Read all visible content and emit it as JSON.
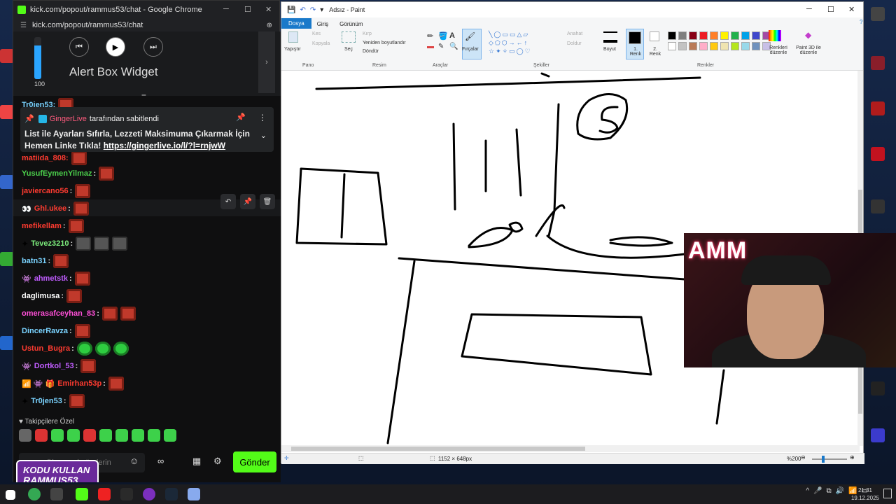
{
  "chrome": {
    "title": "kick.com/popout/rammus53/chat - Google Chrome",
    "url": "kick.com/popout/rammus53/chat"
  },
  "widget": {
    "title": "Alert Box Widget",
    "volume": "100",
    "volume_fraction": 0.8
  },
  "pinned": {
    "user": "GingerLive",
    "action": "tarafından sabitlendi",
    "text": "List ile Ayarları Sıfırla, Lezzeti Maksimuma Çıkarmak İçin Hemen Linke Tıkla!",
    "link": "https://gingerlive.io/l/?l=rnjwW"
  },
  "chat": {
    "partial_top": "Tr0jen53:",
    "partial_top2": "matiida_808:",
    "messages": [
      {
        "user": "YusufEymenYilmaz",
        "color": "#4bcf4b",
        "emotes": [
          "r"
        ]
      },
      {
        "user": "javiercano56",
        "color": "#ff3b30",
        "emotes": [
          "r"
        ]
      },
      {
        "user": "Ghl.ukee",
        "color": "#ff3b30",
        "emotes": [
          "r"
        ],
        "badge": "👀"
      },
      {
        "user": "mefikellam",
        "color": "#ff3b30",
        "emotes": [
          "r"
        ]
      },
      {
        "user": "Tevez3210",
        "color": "#7ef07e",
        "emotes": [
          "p",
          "p",
          "p"
        ],
        "badge": "✦"
      },
      {
        "user": "batn31",
        "color": "#7ad3ff",
        "emotes": [
          "r"
        ]
      },
      {
        "user": "ahmetstk",
        "color": "#c05cff",
        "emotes": [
          "r"
        ],
        "badge": "👾"
      },
      {
        "user": "daglimusa",
        "color": "#ffffff",
        "emotes": [
          "r"
        ]
      },
      {
        "user": "omerasafceyhan_83",
        "color": "#ff4fd8",
        "emotes": [
          "r",
          "r"
        ]
      },
      {
        "user": "DincerRavza",
        "color": "#7ad3ff",
        "emotes": [
          "r"
        ]
      },
      {
        "user": "Ustun_Bugra",
        "color": "#ff3b30",
        "emotes": [
          "g",
          "g",
          "g"
        ]
      },
      {
        "user": "Dortkol_53",
        "color": "#c05cff",
        "emotes": [
          "r"
        ],
        "badge": "👾"
      },
      {
        "user": "Emirhan53p",
        "color": "#ff3b30",
        "emotes": [
          "r"
        ],
        "badge": "📶 👾 🎁"
      },
      {
        "user": "Tr0jen53",
        "color": "#7ad3ff",
        "emotes": [
          "r"
        ],
        "badge": "✦"
      }
    ],
    "followers_label": "Takipçilere Özel",
    "composer_placeholder": "Bir mesaj gönderin",
    "send_label": "Gönder",
    "promo_line1": "KODU KULLAN",
    "promo_line2": "RAMMUS53"
  },
  "paint": {
    "title": "Adsız - Paint",
    "tabs": [
      "Dosya",
      "Giriş",
      "Görünüm"
    ],
    "groups": {
      "pano": "Pano",
      "resim": "Resim",
      "araclar": "Araçlar",
      "sekiller": "Şekiller",
      "renkler": "Renkler"
    },
    "items": {
      "yapistir": "Yapıştır",
      "kes": "Kes",
      "kopyala": "Kopyala",
      "sec": "Seç",
      "kirp": "Kırp",
      "yeniden": "Yeniden boyutlandır",
      "dondur": "Döndür",
      "fircalar": "Fırçalar",
      "anahat": "Anahat",
      "doldur": "Doldur",
      "boyut": "Boyut",
      "renk1": "1. Renk",
      "renk2": "2. Renk",
      "renkleri_duzenle": "Renkleri düzenle",
      "paint3d": "Paint 3D ile düzenle"
    },
    "palette": [
      "#000000",
      "#7f7f7f",
      "#880015",
      "#ed1c24",
      "#ff7f27",
      "#fff200",
      "#22b14c",
      "#00a2e8",
      "#3f48cc",
      "#a349a4",
      "#ffffff",
      "#c3c3c3",
      "#b97a57",
      "#ffaec9",
      "#ffc90e",
      "#efe4b0",
      "#b5e61d",
      "#99d9ea",
      "#7092be",
      "#c8bfe7"
    ],
    "status_size": "1152 × 648px",
    "zoom": "%200"
  },
  "webcam": {
    "overlay_text": "AMM"
  },
  "taskbar": {
    "time": "21:31",
    "date": "19.12.2025"
  }
}
